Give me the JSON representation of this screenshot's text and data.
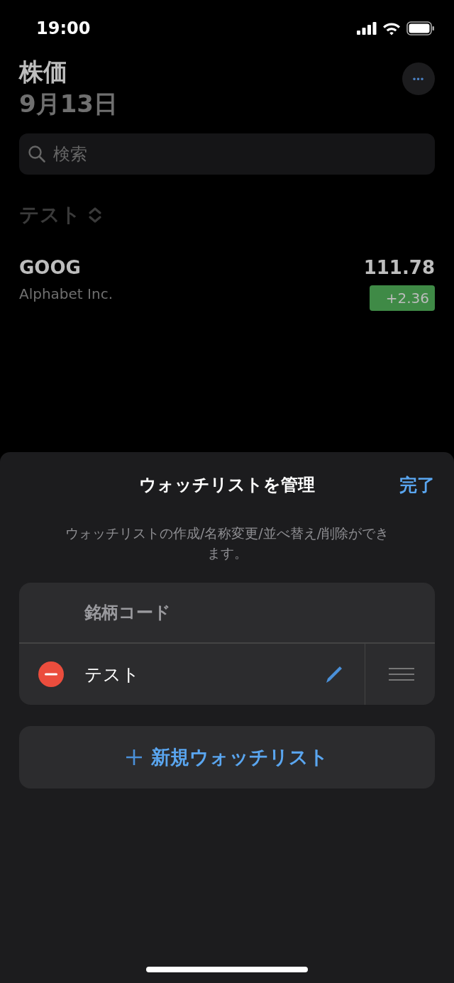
{
  "status_bar": {
    "time": "19:00"
  },
  "header": {
    "title": "株価",
    "date": "9月13日",
    "more_button": "•••"
  },
  "search": {
    "placeholder": "検索"
  },
  "watchlist_picker": {
    "label": "テスト"
  },
  "stocks": [
    {
      "symbol": "GOOG",
      "name": "Alphabet Inc.",
      "price": "111.78",
      "change": "+2.36",
      "color": "#3f8a46"
    }
  ],
  "sheet": {
    "title": "ウォッチリストを管理",
    "done_button": "完了",
    "description": "ウォッチリストの作成/名称変更/並べ替え/削除ができます。",
    "fixed_list": "銘柄コード",
    "watchlists": [
      {
        "name": "テスト"
      }
    ],
    "new_button": "新規ウォッチリスト"
  }
}
